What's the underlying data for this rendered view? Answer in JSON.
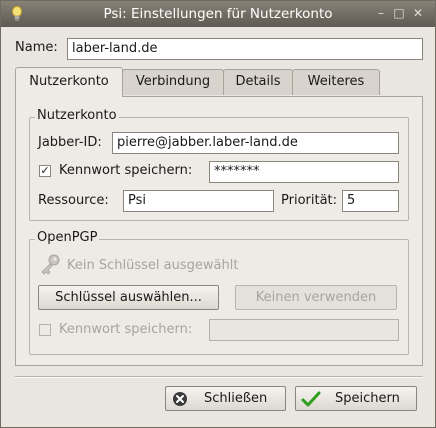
{
  "window": {
    "title": "Psi: Einstellungen für Nutzerkonto",
    "icon": "lightbulb-icon",
    "controls": [
      "minimize-icon",
      "maximize-icon",
      "close-icon"
    ]
  },
  "name": {
    "label": "Name:",
    "value": "laber-land.de"
  },
  "tabs": [
    {
      "label": "Nutzerkonto",
      "active": true
    },
    {
      "label": "Verbindung",
      "active": false
    },
    {
      "label": "Details",
      "active": false
    },
    {
      "label": "Weiteres",
      "active": false
    }
  ],
  "account_group": {
    "title": "Nutzerkonto",
    "jid_label": "Jabber-ID:",
    "jid_value": "pierre@jabber.laber-land.de",
    "save_password_label": "Kennwort speichern:",
    "save_password_checked": true,
    "password_value": "*******",
    "resource_label": "Ressource:",
    "resource_value": "Psi",
    "priority_label": "Priorität:",
    "priority_value": "5"
  },
  "openpgp_group": {
    "title": "OpenPGP",
    "no_key_text": "Kein Schlüssel ausgewählt",
    "select_key_button": "Schlüssel auswählen...",
    "dont_use_button": "Keinen verwenden",
    "save_passphrase_label": "Kennwort speichern:",
    "save_passphrase_checked": false,
    "passphrase_value": ""
  },
  "footer": {
    "close_button": "Schließen",
    "save_button": "Speichern"
  },
  "colors": {
    "titlebar": "#6d675f",
    "save_check": "#2e9e1e",
    "close_icon": "#3a3a3a"
  }
}
